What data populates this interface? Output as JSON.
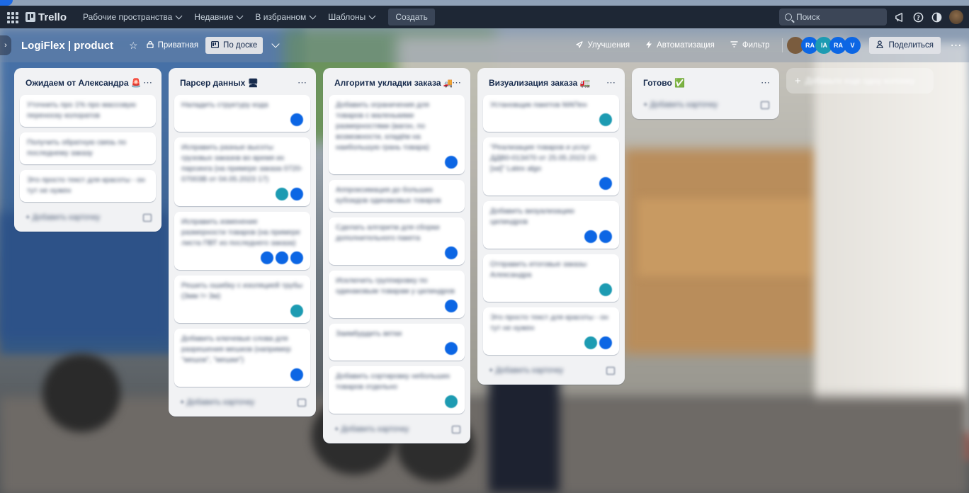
{
  "topbar": {
    "logo": "Trello",
    "nav": [
      {
        "label": "Рабочие пространства"
      },
      {
        "label": "Недавние"
      },
      {
        "label": "В избранном"
      },
      {
        "label": "Шаблоны"
      }
    ],
    "create_label": "Создать",
    "search_placeholder": "Поиск"
  },
  "board": {
    "title": "LogiFlex | product",
    "visibility": "Приватная",
    "view": "По доске",
    "improvements": "Улучшения",
    "automation": "Автоматизация",
    "filter": "Фильтр",
    "share": "Поделиться",
    "members": [
      {
        "initials": "",
        "color": "#7a5c3e"
      },
      {
        "initials": "RA",
        "color": "#0c66e4"
      },
      {
        "initials": "IA",
        "color": "#1d9bb2"
      },
      {
        "initials": "RA",
        "color": "#0c66e4"
      },
      {
        "initials": "V",
        "color": "#0c66e4"
      }
    ]
  },
  "lists": [
    {
      "title": "Ожидаем от Александра 🚨",
      "cards": [
        {
          "text": "Уточнить про 1% про массовую переноску колоратов",
          "members": []
        },
        {
          "text": "Получить обратную связь по последнему заказу",
          "members": []
        },
        {
          "text": "Это просто текст для красоты - он тут не нужен",
          "members": []
        }
      ],
      "add_card": "Добавить карточку"
    },
    {
      "title": "Парсер данных 🖥",
      "cards": [
        {
          "text": "Наладить структуру кода",
          "members": [
            "#0c66e4"
          ]
        },
        {
          "text": "Исправить разные высоты грузовых заказов во время их парсинга (на примере заказа 0720-07003В от 04.05.2023 17)",
          "members": [
            "#1d9bb2",
            "#0c66e4"
          ]
        },
        {
          "text": "Исправить изменение размерности товаров (на примере листа ПВТ из последнего заказа)",
          "members": [
            "#0c66e4",
            "#0c66e4",
            "#0c66e4"
          ]
        },
        {
          "text": "Решить ошибку с изоляцией трубы (3мм != 3м)",
          "members": [
            "#1d9bb2"
          ]
        },
        {
          "text": "Добавить ключевые слова для разрешения мешков (например \"мешок\", \"мешки\")",
          "members": [
            "#0c66e4"
          ]
        }
      ],
      "add_card": "Добавить карточку"
    },
    {
      "title": "Алгоритм укладки заказа 🚚",
      "cards": [
        {
          "text": "Добавить ограничения для товаров с маленькими размерностями (вагон, по возможности, кладём на наибольшую грань товара)",
          "members": [
            "#0c66e4"
          ]
        },
        {
          "text": "Аппроксимация до больших кубоидов одинаковых товаров",
          "members": []
        },
        {
          "text": "Сделать алгоритм для сборки дополнительного пакета",
          "members": [
            "#0c66e4"
          ]
        },
        {
          "text": "Исключить группировку по одинаковым товарам у цилиндров",
          "members": [
            "#0c66e4"
          ]
        },
        {
          "text": "Заимбурдить ветки",
          "members": [
            "#0c66e4"
          ]
        },
        {
          "text": "Добавить сортировку небольших товаров отдельно",
          "members": [
            "#1d9bb2"
          ]
        }
      ],
      "add_card": "Добавить карточку"
    },
    {
      "title": "Визуализация заказа 🚛",
      "cards": [
        {
          "text": "Установщик пакетов МАПен",
          "members": [
            "#1d9bb2"
          ]
        },
        {
          "text": "\"Реализация товаров и услуг ДДВ0-013470 от 25.05.2023 15:[хи]\" Latex algo",
          "members": [
            "#0c66e4"
          ]
        },
        {
          "text": "Добавить визуализацию цилиндров",
          "members": [
            "#0c66e4",
            "#0c66e4"
          ]
        },
        {
          "text": "Отправить итоговые заказы Александра",
          "members": [
            "#1d9bb2"
          ]
        },
        {
          "text": "Это просто текст для красоты - он тут не нужен",
          "members": [
            "#1d9bb2",
            "#0c66e4"
          ]
        }
      ],
      "add_card": "Добавить карточку"
    },
    {
      "title": "Готово ✅",
      "cards": [],
      "add_card": "Добавить карточку"
    }
  ],
  "add_list": "Добавьте еще одну колонку"
}
